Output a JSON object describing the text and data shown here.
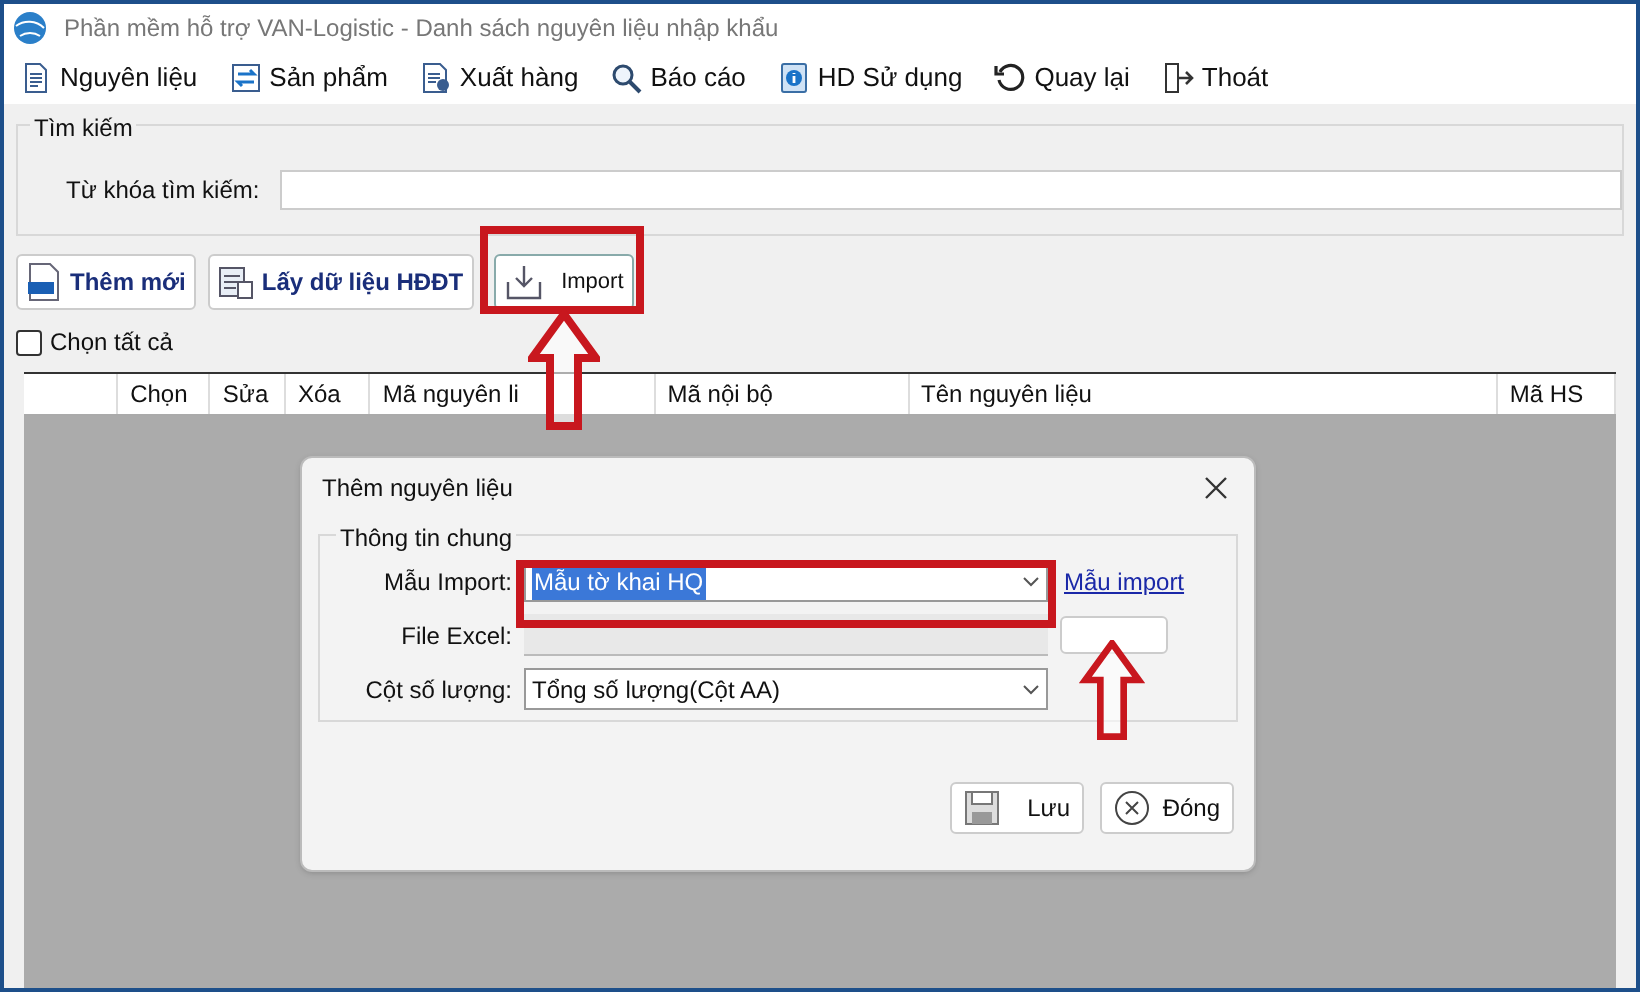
{
  "window": {
    "title": "Phần mềm hỗ trợ VAN-Logistic - Danh sách nguyên liệu nhập khẩu"
  },
  "menu": [
    {
      "label": "Nguyên liệu",
      "kind": "doc"
    },
    {
      "label": "Sản phẩm",
      "kind": "swap"
    },
    {
      "label": "Xuất hàng",
      "kind": "export"
    },
    {
      "label": "Báo cáo",
      "kind": "search"
    },
    {
      "label": "HD Sử dụng",
      "kind": "info"
    },
    {
      "label": "Quay lại",
      "kind": "back"
    },
    {
      "label": "Thoát",
      "kind": "exit"
    }
  ],
  "search": {
    "group_title": "Tìm kiếm",
    "label": "Từ khóa tìm kiếm:"
  },
  "actions": [
    {
      "label": "Thêm mới",
      "kind": "new"
    },
    {
      "label": "Lấy dữ liệu HĐĐT",
      "kind": "fetch"
    },
    {
      "label": "Import",
      "kind": "import"
    }
  ],
  "select_all": {
    "label": "Chọn tất cả",
    "checked": false
  },
  "table": {
    "columns": [
      "Chọn",
      "Sửa",
      "Xóa",
      "Mã nguyên li",
      "Mã nội bộ",
      "Tên nguyên liệu",
      "Mã HS"
    ]
  },
  "dialog": {
    "title": "Thêm nguyên liệu",
    "group_title": "Thông tin chung",
    "template_label": "Mẫu Import:",
    "template_value": "Mẫu tờ khai HQ",
    "template_link": "Mẫu import",
    "file_label": "File Excel:",
    "qty_label": "Cột số lượng:",
    "qty_value": "Tổng số lượng(Cột AA)",
    "buttons": [
      {
        "label": "Lưu",
        "kind": "save"
      },
      {
        "label": "Đóng",
        "kind": "close"
      }
    ]
  }
}
